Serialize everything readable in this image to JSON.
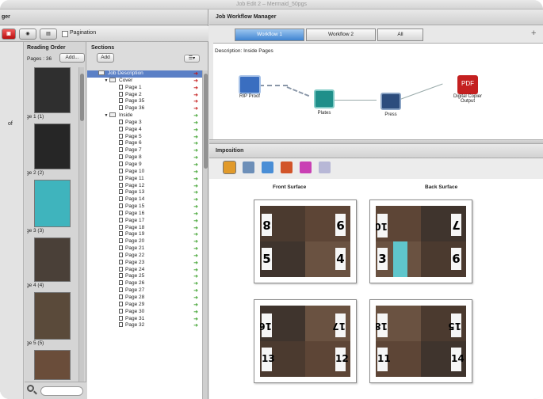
{
  "window": {
    "title": "Job Edit 2 – Mermaid_50pgs"
  },
  "left_panel": {
    "header": "ger",
    "toolbar": {
      "pagination_label": "Pagination"
    },
    "far_left_fragment": "of",
    "reading_order": {
      "title": "Reading Order",
      "pages_label": "Pages : 36",
      "add_label": "Add...",
      "thumbnails": [
        {
          "label": "Page 1 (1)",
          "tone": "#2f2f2f"
        },
        {
          "label": "Page 2 (2)",
          "tone": "#262626"
        },
        {
          "label": "Page 3 (3)",
          "tone": "#3fb4bd"
        },
        {
          "label": "Page 4 (4)",
          "tone": "#4a4038"
        },
        {
          "label": "Page 5 (5)",
          "tone": "#5a4a3a"
        },
        {
          "label": "",
          "tone": "#6a4d3a"
        }
      ]
    },
    "sections": {
      "title": "Sections",
      "add_label": "Add",
      "menu_glyph": "☰▾",
      "tree": [
        {
          "label": "Job Description",
          "level": 0,
          "type": "job",
          "selected": true,
          "arrow": "red"
        },
        {
          "label": "Cover",
          "level": 1,
          "type": "folder",
          "selected": false,
          "arrow": "red"
        },
        {
          "label": "Page 1",
          "level": 2,
          "type": "page",
          "selected": false,
          "arrow": "red"
        },
        {
          "label": "Page 2",
          "level": 2,
          "type": "page",
          "selected": false,
          "arrow": "red"
        },
        {
          "label": "Page 35",
          "level": 2,
          "type": "page",
          "selected": false,
          "arrow": "red"
        },
        {
          "label": "Page 36",
          "level": 2,
          "type": "page",
          "selected": false,
          "arrow": "red"
        },
        {
          "label": "Inside",
          "level": 1,
          "type": "folder",
          "selected": false,
          "arrow": "green"
        },
        {
          "label": "Page 3",
          "level": 2,
          "type": "page",
          "selected": false,
          "arrow": "green"
        },
        {
          "label": "Page 4",
          "level": 2,
          "type": "page",
          "selected": false,
          "arrow": "green"
        },
        {
          "label": "Page 5",
          "level": 2,
          "type": "page",
          "selected": false,
          "arrow": "green"
        },
        {
          "label": "Page 6",
          "level": 2,
          "type": "page",
          "selected": false,
          "arrow": "green"
        },
        {
          "label": "Page 7",
          "level": 2,
          "type": "page",
          "selected": false,
          "arrow": "green"
        },
        {
          "label": "Page 8",
          "level": 2,
          "type": "page",
          "selected": false,
          "arrow": "green"
        },
        {
          "label": "Page 9",
          "level": 2,
          "type": "page",
          "selected": false,
          "arrow": "green"
        },
        {
          "label": "Page 10",
          "level": 2,
          "type": "page",
          "selected": false,
          "arrow": "green"
        },
        {
          "label": "Page 11",
          "level": 2,
          "type": "page",
          "selected": false,
          "arrow": "green"
        },
        {
          "label": "Page 12",
          "level": 2,
          "type": "page",
          "selected": false,
          "arrow": "green"
        },
        {
          "label": "Page 13",
          "level": 2,
          "type": "page",
          "selected": false,
          "arrow": "green"
        },
        {
          "label": "Page 14",
          "level": 2,
          "type": "page",
          "selected": false,
          "arrow": "green"
        },
        {
          "label": "Page 15",
          "level": 2,
          "type": "page",
          "selected": false,
          "arrow": "green"
        },
        {
          "label": "Page 16",
          "level": 2,
          "type": "page",
          "selected": false,
          "arrow": "green"
        },
        {
          "label": "Page 17",
          "level": 2,
          "type": "page",
          "selected": false,
          "arrow": "green"
        },
        {
          "label": "Page 18",
          "level": 2,
          "type": "page",
          "selected": false,
          "arrow": "green"
        },
        {
          "label": "Page 19",
          "level": 2,
          "type": "page",
          "selected": false,
          "arrow": "green"
        },
        {
          "label": "Page 20",
          "level": 2,
          "type": "page",
          "selected": false,
          "arrow": "green"
        },
        {
          "label": "Page 21",
          "level": 2,
          "type": "page",
          "selected": false,
          "arrow": "green"
        },
        {
          "label": "Page 22",
          "level": 2,
          "type": "page",
          "selected": false,
          "arrow": "green"
        },
        {
          "label": "Page 23",
          "level": 2,
          "type": "page",
          "selected": false,
          "arrow": "green"
        },
        {
          "label": "Page 24",
          "level": 2,
          "type": "page",
          "selected": false,
          "arrow": "green"
        },
        {
          "label": "Page 25",
          "level": 2,
          "type": "page",
          "selected": false,
          "arrow": "green"
        },
        {
          "label": "Page 26",
          "level": 2,
          "type": "page",
          "selected": false,
          "arrow": "green"
        },
        {
          "label": "Page 27",
          "level": 2,
          "type": "page",
          "selected": false,
          "arrow": "green"
        },
        {
          "label": "Page 28",
          "level": 2,
          "type": "page",
          "selected": false,
          "arrow": "green"
        },
        {
          "label": "Page 29",
          "level": 2,
          "type": "page",
          "selected": false,
          "arrow": "green"
        },
        {
          "label": "Page 30",
          "level": 2,
          "type": "page",
          "selected": false,
          "arrow": "green"
        },
        {
          "label": "Page 31",
          "level": 2,
          "type": "page",
          "selected": false,
          "arrow": "green"
        },
        {
          "label": "Page 32",
          "level": 2,
          "type": "page",
          "selected": false,
          "arrow": "green"
        }
      ]
    }
  },
  "workflow_manager": {
    "title": "Job Workflow Manager",
    "tabs": [
      "Workflow 1",
      "Workflow 2",
      "All"
    ],
    "active_tab": 0,
    "description": "Description:   Inside Pages",
    "nodes": [
      {
        "name": "rip-proof",
        "label": "RIP Proof",
        "color": "#3a6ec0"
      },
      {
        "name": "plates",
        "label": "Plates",
        "color": "#1f8f8a"
      },
      {
        "name": "press",
        "label": "Press",
        "color": "#2d4d7d"
      },
      {
        "name": "digital-copier",
        "label": "Digital Copier Output",
        "color": "#c42020"
      }
    ]
  },
  "imposition": {
    "title": "Imposition",
    "toolbar": [
      {
        "name": "layout-tool-icon",
        "color": "#e19a2a"
      },
      {
        "name": "preview-tool-icon",
        "color": "#6d8fb8"
      },
      {
        "name": "cube-tool-icon",
        "color": "#4a8ed6"
      },
      {
        "name": "marks-tool-icon",
        "color": "#d2552a"
      },
      {
        "name": "color-tool-icon",
        "color": "#c940b4"
      },
      {
        "name": "grid-tool-icon",
        "color": "#b7b7d6"
      }
    ],
    "front_label": "Front Surface",
    "back_label": "Back Surface",
    "sheets": [
      {
        "cells": [
          {
            "n": "8",
            "rot": true
          },
          {
            "n": "9",
            "rot": true
          },
          {
            "n": "5",
            "rot": false
          },
          {
            "n": "4",
            "rot": false
          }
        ]
      },
      {
        "cells": [
          {
            "n": "10",
            "rot": true
          },
          {
            "n": "7",
            "rot": true
          },
          {
            "n": "3",
            "rot": false
          },
          {
            "n": "6",
            "rot": false
          }
        ]
      },
      {
        "cells": [
          {
            "n": "16",
            "rot": true
          },
          {
            "n": "17",
            "rot": true
          },
          {
            "n": "13",
            "rot": false
          },
          {
            "n": "12",
            "rot": false
          }
        ]
      },
      {
        "cells": [
          {
            "n": "18",
            "rot": true
          },
          {
            "n": "15",
            "rot": true
          },
          {
            "n": "11",
            "rot": false
          },
          {
            "n": "14",
            "rot": false
          }
        ]
      }
    ]
  }
}
